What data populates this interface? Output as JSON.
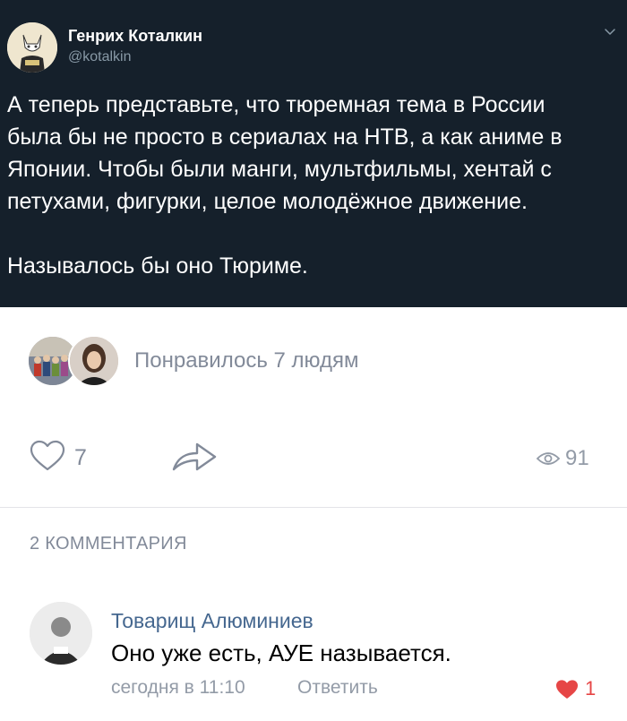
{
  "tweet": {
    "author": "Генрих Коталкин",
    "handle": "@kotalkin",
    "avatar_icon": "cat-avatar-icon",
    "text": "А теперь представьте, что тюремная тема в России\nбыла бы не просто в сериалах на НТВ, а как аниме в\nЯпонии. Чтобы были манги, мультфильмы, хентай с\nпетухами, фигурки, целое молодёжное движение.\n\nНазывалось бы оно Тюриме.",
    "background": "#15202b"
  },
  "post": {
    "liked_by": "Понравилось 7 людям",
    "likes_count": "7",
    "views_count": "91",
    "comments_heading": "2 КОММЕНТАРИЯ"
  },
  "comment": {
    "author": "Товарищ Алюминиев",
    "text": "Оно уже есть, АУЕ называется.",
    "time": "сегодня в 11:10",
    "reply_label": "Ответить",
    "likes": "1",
    "author_color": "#45678f",
    "heart_color": "#e64646"
  }
}
